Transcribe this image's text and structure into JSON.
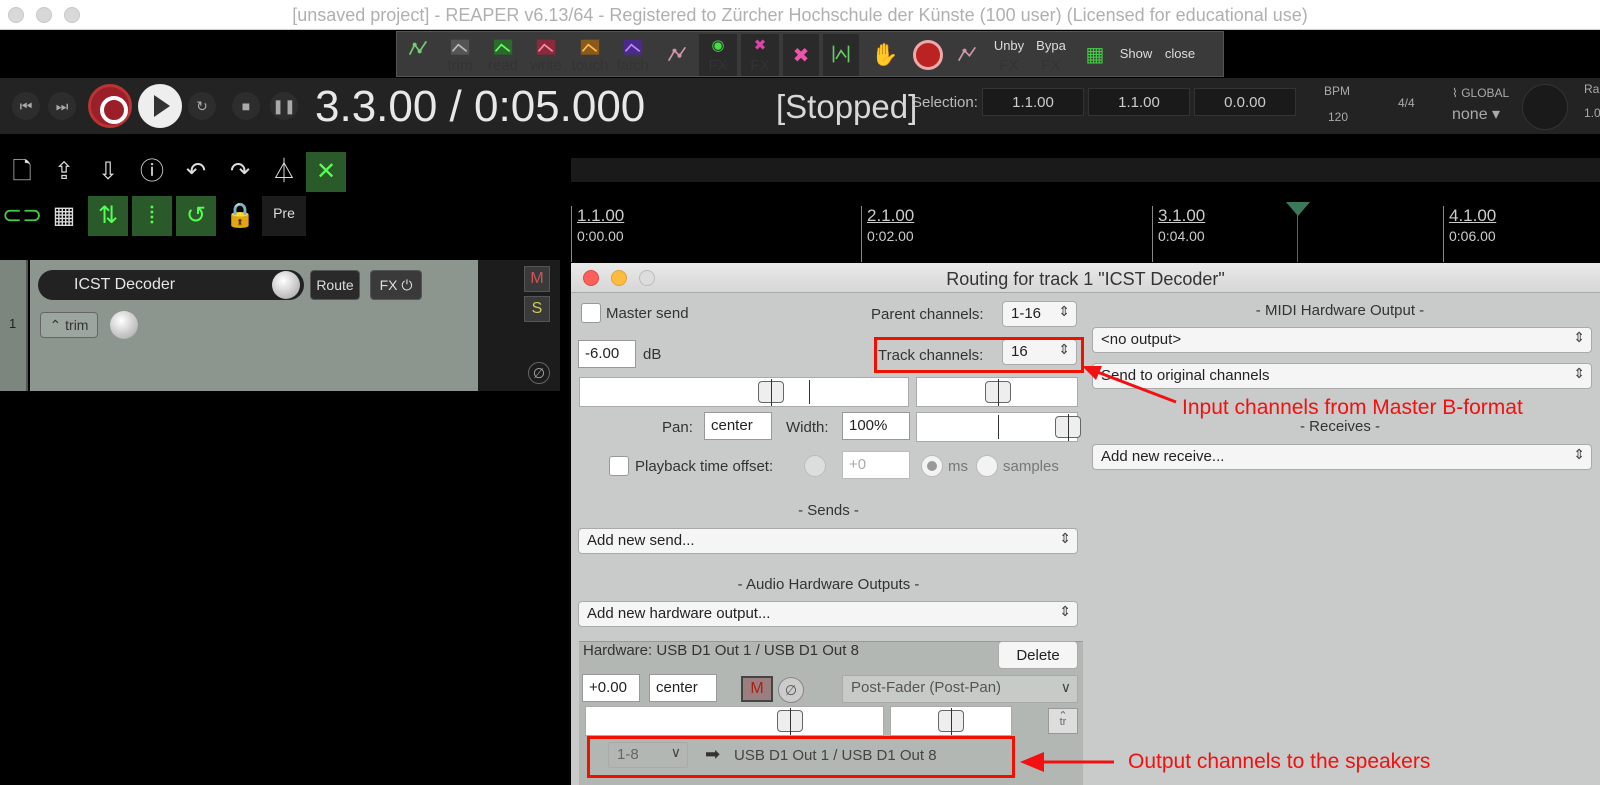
{
  "window": {
    "title": "[unsaved project] - REAPER v6.13/64 - Registered to Zürcher Hochschule der Künste (100 user) (Licensed for educational use)"
  },
  "envbar": {
    "buttons": [
      "trim",
      "read",
      "write",
      "touch",
      "latch",
      "FX",
      "FX",
      "Unby FX",
      "Bypa FX",
      "Show",
      "close"
    ],
    "unby1": "Unby",
    "unby2": "FX",
    "bypa1": "Bypa",
    "bypa2": "FX"
  },
  "transport": {
    "position": "3.3.00 / 0:05.000",
    "state": "[Stopped]",
    "selection_label": "Selection:",
    "selection": [
      "1.1.00",
      "1.1.00",
      "0.0.00"
    ],
    "bpm_label": "BPM",
    "bpm": "120",
    "timesig": "4/4",
    "global_label": "GLOBAL",
    "global_value": "none",
    "rate_label": "Ra",
    "rate_value": "1.0"
  },
  "toolbar": {
    "pre_label": "Pre"
  },
  "ruler": [
    {
      "bar": "1.1.00",
      "time": "0:00.00"
    },
    {
      "bar": "2.1.00",
      "time": "0:02.00"
    },
    {
      "bar": "3.1.00",
      "time": "0:04.00"
    },
    {
      "bar": "4.1.00",
      "time": "0:06.00"
    }
  ],
  "track": {
    "number": "1",
    "name": "ICST Decoder",
    "route_label": "Route",
    "fx_label": "FX",
    "trim_label": "trim",
    "mute_label": "M",
    "solo_label": "S",
    "phase_symbol": "∅"
  },
  "routing": {
    "title": "Routing for track 1 \"ICST Decoder\"",
    "master_send": "Master send",
    "parent_channels_label": "Parent channels:",
    "parent_channels": "1-16",
    "volume": "-6.00",
    "db_label": "dB",
    "track_channels_label": "Track channels:",
    "track_channels": "16",
    "pan_label": "Pan:",
    "pan": "center",
    "width_label": "Width:",
    "width": "100%",
    "playback_offset_label": "Playback time offset:",
    "playback_offset": "+0",
    "ms_label": "ms",
    "samples_label": "samples",
    "sends_header": "-  Sends  -",
    "add_send": "Add new send...",
    "hw_outputs_header": "-  Audio Hardware Outputs  -",
    "add_hw_output": "Add new hardware output...",
    "hw_label": "Hardware: USB D1 Out 1 / USB D1 Out 8",
    "delete_label": "Delete",
    "hw_volume": "+0.00",
    "hw_pan": "center",
    "hw_mute": "M",
    "hw_phase": "∅",
    "hw_mode": "Post-Fader (Post-Pan)",
    "tr_label": "tr",
    "hw_channels": "1-8",
    "hw_dest": "USB D1 Out 1 / USB D1 Out 8",
    "midi_header": "-  MIDI Hardware Output  -",
    "midi_output": "<no output>",
    "midi_channels": "Send to original channels",
    "receives_header": "-  Receives  -",
    "add_receive": "Add new receive..."
  },
  "annotations": {
    "input": "Input channels from Master B-format",
    "output": "Output channels to the speakers"
  },
  "colors": {
    "annotation": "#f21010",
    "record": "#9a1f29",
    "route_bg": "#c8cbc9"
  }
}
